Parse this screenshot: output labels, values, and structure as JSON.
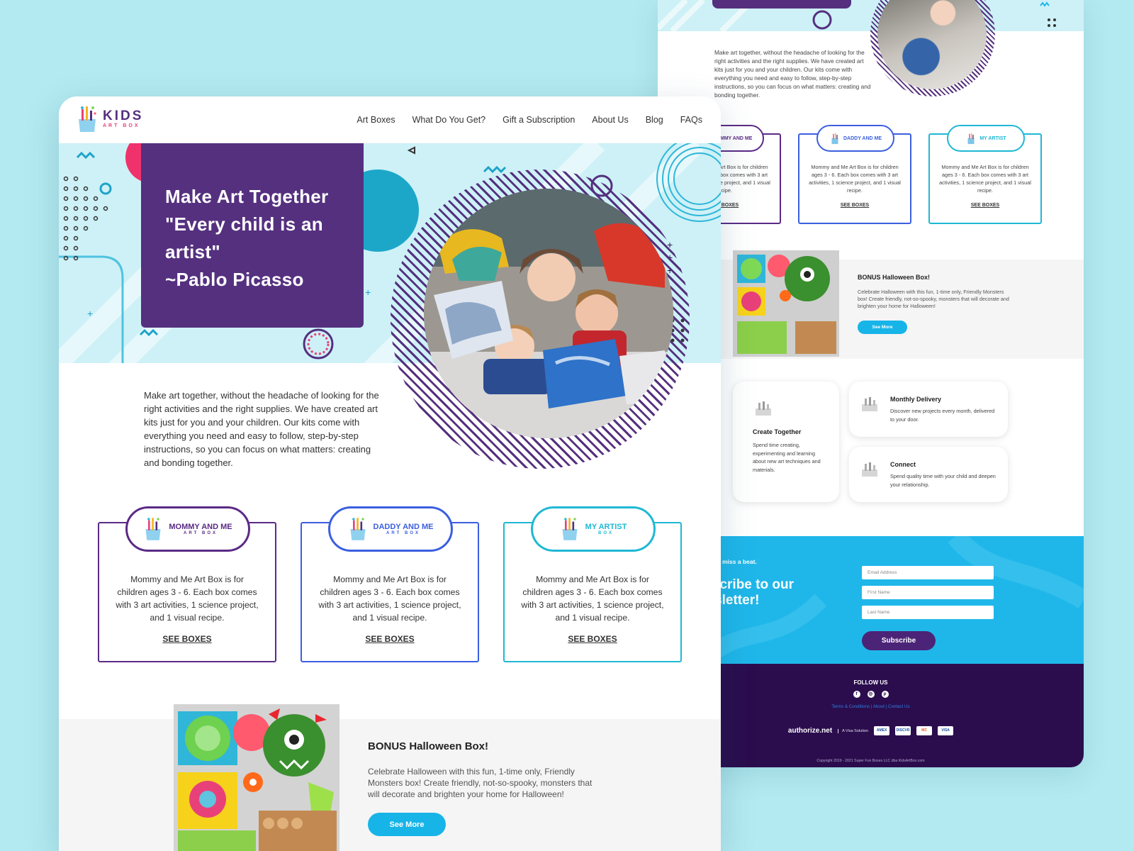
{
  "brand": {
    "name": "KIDS",
    "tagline": "ART BOX"
  },
  "nav": [
    "Art Boxes",
    "What Do You Get?",
    "Gift a Subscription",
    "About Us",
    "Blog",
    "FAQs"
  ],
  "hero": {
    "lines": [
      "Make Art Together",
      "\"Every child is an",
      "artist\"",
      "~Pablo Picasso"
    ]
  },
  "intro": "Make art together, without the headache of looking for the right activities and the right supplies. We have created art kits just for you and your children. Our kits come with everything you need and easy to follow, step-by-step instructions, so you can focus on what matters: creating and bonding together.",
  "boxes": [
    {
      "title": "MOMMY AND ME",
      "subtitle": "ART BOX",
      "description": "Mommy and Me Art Box is for children ages 3 - 6. Each box comes with 3 art activities, 1 science project, and 1 visual recipe.",
      "link": "SEE BOXES",
      "color": "#5b2a86"
    },
    {
      "title": "DADDY AND ME",
      "subtitle": "ART BOX",
      "description": "Mommy and Me Art Box is for children ages 3 - 6. Each box comes with 3 art activities, 1 science project, and 1 visual recipe.",
      "link": "SEE BOXES",
      "color": "#3b5fe0"
    },
    {
      "title": "MY ARTIST",
      "subtitle": "BOX",
      "description": "Mommy and Me Art Box is for children ages 3 - 6. Each box comes with 3 art activities, 1 science project, and 1 visual recipe.",
      "link": "SEE BOXES",
      "color": "#1fb8d4"
    }
  ],
  "bonus": {
    "title": "BONUS Halloween Box!",
    "text": "Celebrate Halloween with this fun, 1-time only, Friendly Monsters box! Create friendly, not-so-spooky, monsters that will decorate and brighten your home for Halloween!",
    "button": "See More"
  },
  "features": [
    {
      "title": "Create Together",
      "text": "Spend time creating, experimenting and learning about new art techniques and materials."
    },
    {
      "title": "Monthly Delivery",
      "text": "Discover new projects every month, delivered to your door."
    },
    {
      "title": "Connect",
      "text": "Spend quality time with your child and deepen your relationship."
    }
  ],
  "newsletter": {
    "kicker": "Never miss a beat.",
    "title": "Subscribe to our Newsletter!",
    "email_placeholder": "Email Address",
    "first_placeholder": "First Name",
    "last_placeholder": "Last Name",
    "button": "Subscribe"
  },
  "footer": {
    "follow": "FOLLOW US",
    "links": [
      "Terms & Conditions",
      "About",
      "Contact Us"
    ],
    "payment_brand": "authorize.net",
    "payment_note": "A Visa Solution",
    "cards": [
      "AMEX",
      "DISCVR",
      "MC",
      "VISA"
    ],
    "copyright": "Copyright 2019 - 2021 Super Fun Boxes LLC dba KidsArtBox.com"
  },
  "colors": {
    "purple": "#55307f",
    "accent_blue": "#17b4e8",
    "hero_bg": "#cdf1f7",
    "page_bg": "#b3e9f0",
    "footer_bg": "#2b0d4e"
  }
}
